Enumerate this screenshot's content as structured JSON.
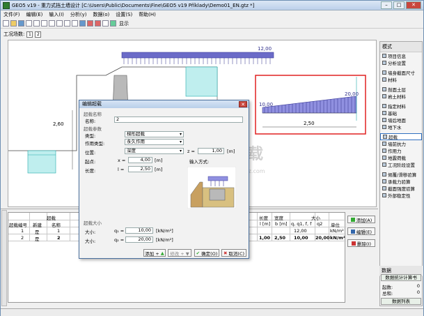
{
  "window": {
    "title": "GEO5 v19 - 重力式挡土墙设计 [C:\\Users\\Public\\Documents\\Fine\\GEO5 v19 Příklady\\Demo01_EN.gtz *]",
    "min": "–",
    "max": "□",
    "close": "✕"
  },
  "menu": [
    "文件(F)",
    "编辑(E)",
    "输入(I)",
    "分析(y)",
    "数据(o)",
    "设置(S)",
    "帮助(H)"
  ],
  "toolbar": {
    "display_label": "显示"
  },
  "stage": {
    "label": "工况场数:",
    "items": [
      "1",
      "2"
    ]
  },
  "canvas": {
    "top_load_value": "12,00",
    "dim_left": "2,60",
    "surcharge_left": "10,00",
    "surcharge_right": "20,00",
    "surcharge_length": "2,50",
    "watermark": "安下载",
    "watermark_sub": "anxz.com",
    "accent_red": "#e02020",
    "teal": "#3fbfbf",
    "load_blue": "#4a4ab8"
  },
  "right_panel": {
    "title": "模式",
    "items": [
      {
        "label": "项目信息",
        "icon": "info-icon"
      },
      {
        "label": "分析设置",
        "icon": "gear-icon"
      },
      {
        "label": "墙身截面尺寸",
        "icon": "wall-icon"
      },
      {
        "label": "材料",
        "icon": "material-icon"
      },
      {
        "label": "剖面土层",
        "icon": "layers-icon"
      },
      {
        "label": "岩土材料",
        "icon": "soil-icon"
      },
      {
        "label": "指定材料",
        "icon": "assign-icon"
      },
      {
        "label": "基础",
        "icon": "foundation-icon"
      },
      {
        "label": "墙后地面",
        "icon": "terrain-icon"
      },
      {
        "label": "地下水",
        "icon": "water-icon"
      },
      {
        "label": "超载",
        "icon": "surcharge-icon"
      },
      {
        "label": "墙前抗力",
        "icon": "resistance-icon"
      },
      {
        "label": "作用力",
        "icon": "force-icon"
      },
      {
        "label": "地震荷载",
        "icon": "earthquake-icon"
      },
      {
        "label": "工况阶段设置",
        "icon": "stage-icon"
      },
      {
        "label": "倾覆/滑移验算",
        "icon": "check-icon"
      },
      {
        "label": "承载力验算",
        "icon": "bearing-icon"
      },
      {
        "label": "截面强度验算",
        "icon": "section-icon"
      },
      {
        "label": "外部稳定性",
        "icon": "stability-icon"
      }
    ],
    "active_index": 10
  },
  "data_panel": {
    "title": "数据",
    "calc_button": "数据统计计算书",
    "rows": [
      {
        "label": "起数:",
        "value": "0"
      },
      {
        "label": "总和:",
        "value": "0"
      }
    ],
    "list_button": "数据列表"
  },
  "grid": {
    "header_top": [
      "超载",
      "",
      "长度",
      "宽度",
      "大小"
    ],
    "headers": [
      "超载编号",
      "新建",
      "名称",
      "",
      "",
      "l [m]",
      "b [m]",
      "q, q1, f, f",
      "q2",
      "单位"
    ],
    "rows": [
      {
        "num": "1",
        "new": "是",
        "name": "1",
        "l": "",
        "b": "",
        "q": "12,00",
        "q2": "",
        "unit": "kN/m²"
      },
      {
        "num": "2",
        "new": "是",
        "name": "2",
        "l": "1,00",
        "b": "2,50",
        "q": "10,00",
        "q2": "20,00",
        "unit": "kN/m²"
      }
    ],
    "side_buttons": [
      "添加(A)",
      "编辑(E)",
      "删除(I)"
    ]
  },
  "dialog": {
    "title": "编辑超载",
    "section_name": "超载名称",
    "name_label": "名称:",
    "name_value": "2",
    "section_params": "超载参数",
    "type_label": "类型:",
    "type_value": "梯形超载",
    "action_label": "作用类型:",
    "action_value": "永久作用",
    "position_label": "位置:",
    "position_value": "深度",
    "z_label": "z =",
    "z_value": "1,00",
    "z_unit": "[m]",
    "start_label": "起点:",
    "start_sym": "x =",
    "start_value": "4,00",
    "start_unit": "[m]",
    "length_label": "长度:",
    "length_sym": "l =",
    "length_value": "2,50",
    "length_unit": "[m]",
    "direction_label": "输入方式:",
    "size_section": "超载大小",
    "size_label": "大小:",
    "q1_sym": "q₁ =",
    "q1_value": "10,00",
    "q1_unit": "[kN/m²]",
    "q2_sym": "q₂ =",
    "q2_value": "20,00",
    "q2_unit": "[kN/m²]",
    "btn_add": "添加 +",
    "btn_add_plus": "▲",
    "btn_edit": "修改 + ▼",
    "btn_ok": "确定(O)",
    "btn_cancel": "取消(C)"
  }
}
